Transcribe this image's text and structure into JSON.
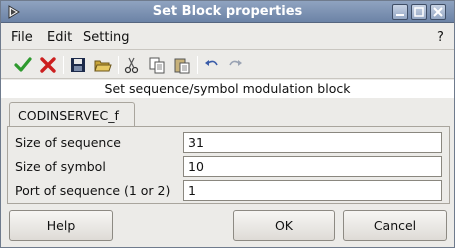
{
  "window": {
    "title": "Set Block properties"
  },
  "menu": {
    "file": "File",
    "edit": "Edit",
    "settings": "Setting",
    "help": "?"
  },
  "heading": "Set sequence/symbol modulation block",
  "tab": {
    "label": "CODINSERVEC_f"
  },
  "fields": [
    {
      "label": "Size of sequence",
      "value": "31"
    },
    {
      "label": "Size of symbol",
      "value": "10"
    },
    {
      "label": "Port of sequence (1 or 2)",
      "value": "1"
    }
  ],
  "buttons": {
    "help": "Help",
    "ok": "OK",
    "cancel": "Cancel"
  },
  "colors": {
    "titlebar": "#7a90b3",
    "ok_check": "#2e9a2e",
    "cancel_x": "#cc1f1f"
  },
  "icons": [
    "app-icon",
    "minimize-icon",
    "maximize-icon",
    "close-icon",
    "check-icon",
    "cancel-icon",
    "save-icon",
    "open-folder-icon",
    "cut-icon",
    "copy-icon",
    "paste-icon",
    "undo-icon",
    "redo-icon"
  ]
}
